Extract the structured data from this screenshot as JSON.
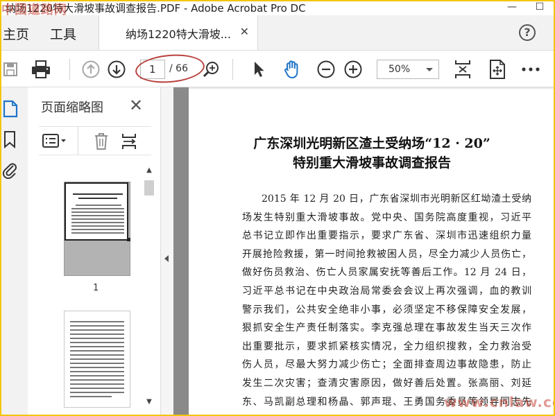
{
  "window": {
    "title": "纳场1220特大滑坡事故调查报告.PDF - Adobe Acrobat Pro DC",
    "watermark_top": "中国道路网",
    "watermark_bottom": "www.cnlaw.com"
  },
  "nav": {
    "home": "主页",
    "tools": "工具",
    "doc_tab": "纳场1220特大滑坡..."
  },
  "toolbar": {
    "current_page": "1",
    "total_pages": "/ 66",
    "zoom": "50%"
  },
  "thumbnails": {
    "title": "页面缩略图",
    "page1_label": "1"
  },
  "document": {
    "title_line1": "广东深圳光明新区渣土受纳场“12 · 20”",
    "title_line2": "特别重大滑坡事故调查报告",
    "lines": [
      "2015 年 12 月 20 日，广东省深圳市光明新区红坳渣土受纳",
      "场发生特别重大滑坡事故。党中央、国务院高度重视，习近平",
      "总书记立即作出重要指示，要求广东省、深圳市迅速组织力量",
      "开展抢险救援，第一时间抢救被困人员，尽全力减少人员伤亡，",
      "做好伤员救治、伤亡人员家属安抚等善后工作。12 月 24 日，",
      "习近平总书记在中央政治局常委会会议上再次强调，血的教训",
      "警示我们，公共安全绝非小事，必须坚定不移保障安全发展，",
      "狠抓安全生产责任制落实。李克强总理在事故发生当天三次作",
      "出重要批示，要求抓紧核实情况，全力组织搜救，全力救治受",
      "伤人员，尽最大努力减少伤亡；全面排查周边事故隐患，防止",
      "发生二次灾害；查清灾害原因，做好善后处置。张高丽、刘延",
      "东、马凯副总理和杨晶、郭声琨、王勇国务委员等领导同志先"
    ]
  }
}
